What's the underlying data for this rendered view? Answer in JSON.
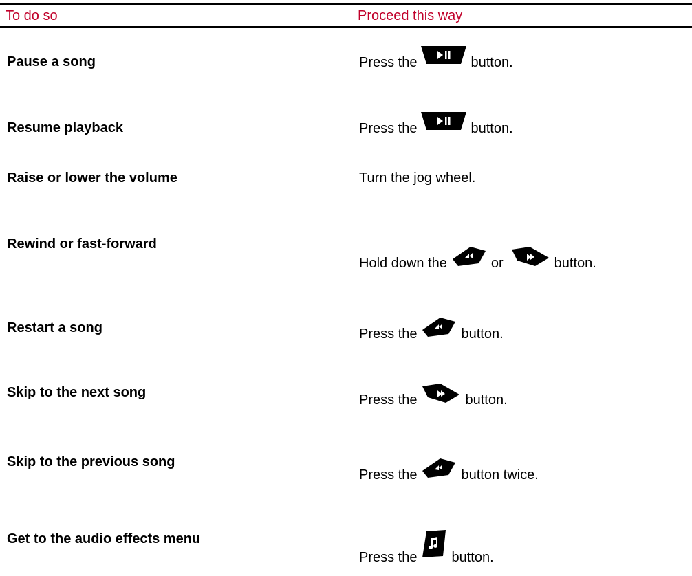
{
  "table": {
    "header": {
      "col_task": "To do so",
      "col_action": "Proceed this way",
      "header_color": "#c0002a"
    },
    "rows": [
      {
        "task": "Pause a song",
        "action_before": "Press the",
        "icon": "play-pause-icon",
        "action_after": "button."
      },
      {
        "task": "Resume playback",
        "action_before": "Press the",
        "icon": "play-pause-icon",
        "action_after": "button."
      },
      {
        "task": "Raise or lower the volume",
        "action_before": "Turn the jog wheel."
      },
      {
        "task": "Rewind or fast-forward",
        "action_before": "Hold down the",
        "icon": "previous-icon",
        "action_middle": "or",
        "icon2": "next-icon",
        "action_after": "button."
      },
      {
        "task": "Restart a song",
        "action_before": "Press the",
        "icon": "previous-icon",
        "action_after": "button."
      },
      {
        "task": "Skip to the next song",
        "action_before": "Press the",
        "icon": "next-icon",
        "action_after": "button."
      },
      {
        "task": "Skip to the previous song",
        "action_before": "Press the",
        "icon": "previous-icon",
        "action_after": "button twice."
      },
      {
        "task": "Get to the audio effects menu",
        "action_before": "Press the",
        "icon": "music-note-icon",
        "action_after": "button."
      }
    ]
  }
}
